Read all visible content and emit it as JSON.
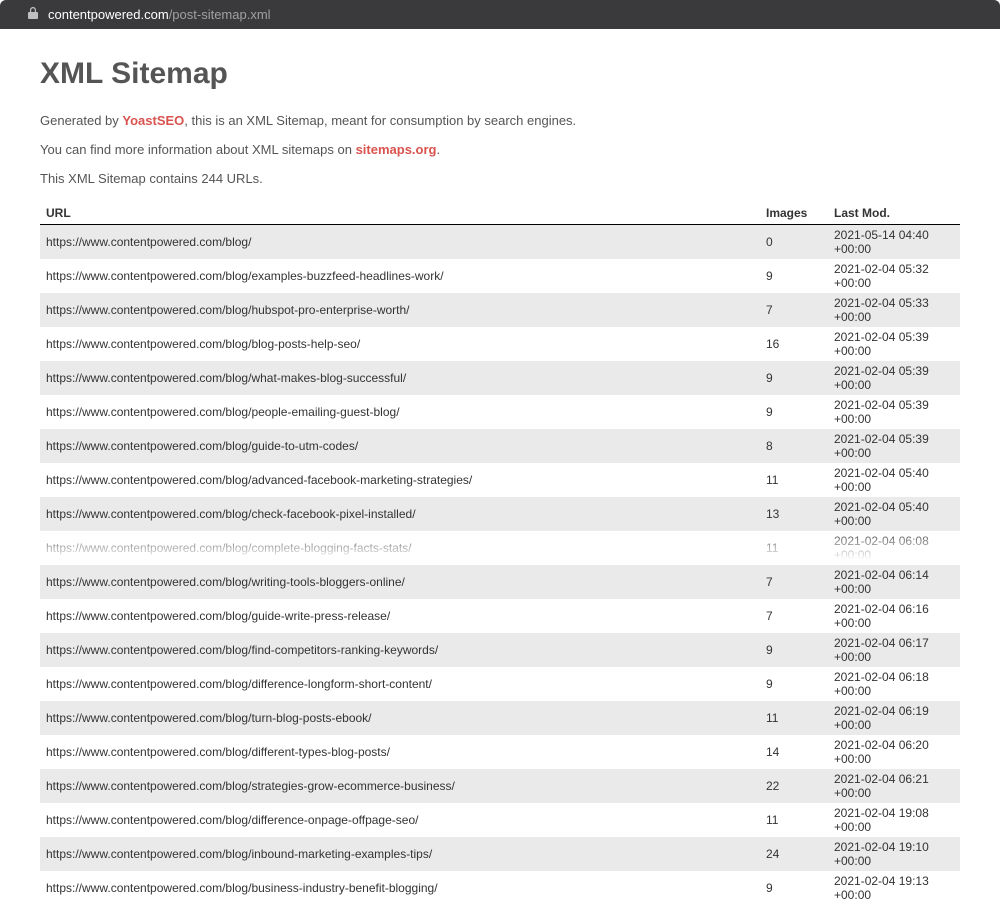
{
  "browser": {
    "domain": "contentpowered.com",
    "path": "/post-sitemap.xml"
  },
  "page": {
    "title": "XML Sitemap",
    "line1_prefix": "Generated by ",
    "line1_link": "YoastSEO",
    "line1_suffix": ", this is an XML Sitemap, meant for consumption by search engines.",
    "line2_prefix": "You can find more information about XML sitemaps on ",
    "line2_link": "sitemaps.org",
    "line2_suffix": ".",
    "count_line": "This XML Sitemap contains 244 URLs."
  },
  "table": {
    "headers": {
      "url": "URL",
      "images": "Images",
      "lastmod": "Last Mod."
    },
    "rows": [
      {
        "url": "https://www.contentpowered.com/blog/",
        "images": "0",
        "lastmod": "2021-05-14 04:40 +00:00"
      },
      {
        "url": "https://www.contentpowered.com/blog/examples-buzzfeed-headlines-work/",
        "images": "9",
        "lastmod": "2021-02-04 05:32 +00:00"
      },
      {
        "url": "https://www.contentpowered.com/blog/hubspot-pro-enterprise-worth/",
        "images": "7",
        "lastmod": "2021-02-04 05:33 +00:00"
      },
      {
        "url": "https://www.contentpowered.com/blog/blog-posts-help-seo/",
        "images": "16",
        "lastmod": "2021-02-04 05:39 +00:00"
      },
      {
        "url": "https://www.contentpowered.com/blog/what-makes-blog-successful/",
        "images": "9",
        "lastmod": "2021-02-04 05:39 +00:00"
      },
      {
        "url": "https://www.contentpowered.com/blog/people-emailing-guest-blog/",
        "images": "9",
        "lastmod": "2021-02-04 05:39 +00:00"
      },
      {
        "url": "https://www.contentpowered.com/blog/guide-to-utm-codes/",
        "images": "8",
        "lastmod": "2021-02-04 05:39 +00:00"
      },
      {
        "url": "https://www.contentpowered.com/blog/advanced-facebook-marketing-strategies/",
        "images": "11",
        "lastmod": "2021-02-04 05:40 +00:00"
      },
      {
        "url": "https://www.contentpowered.com/blog/check-facebook-pixel-installed/",
        "images": "13",
        "lastmod": "2021-02-04 05:40 +00:00"
      },
      {
        "url": "https://www.contentpowered.com/blog/complete-blogging-facts-stats/",
        "images": "11",
        "lastmod": "2021-02-04 06:08 +00:00"
      },
      {
        "url": "https://www.contentpowered.com/blog/writing-tools-bloggers-online/",
        "images": "7",
        "lastmod": "2021-02-04 06:14 +00:00"
      },
      {
        "url": "https://www.contentpowered.com/blog/guide-write-press-release/",
        "images": "7",
        "lastmod": "2021-02-04 06:16 +00:00"
      },
      {
        "url": "https://www.contentpowered.com/blog/find-competitors-ranking-keywords/",
        "images": "9",
        "lastmod": "2021-02-04 06:17 +00:00"
      },
      {
        "url": "https://www.contentpowered.com/blog/difference-longform-short-content/",
        "images": "9",
        "lastmod": "2021-02-04 06:18 +00:00"
      },
      {
        "url": "https://www.contentpowered.com/blog/turn-blog-posts-ebook/",
        "images": "11",
        "lastmod": "2021-02-04 06:19 +00:00"
      },
      {
        "url": "https://www.contentpowered.com/blog/different-types-blog-posts/",
        "images": "14",
        "lastmod": "2021-02-04 06:20 +00:00"
      },
      {
        "url": "https://www.contentpowered.com/blog/strategies-grow-ecommerce-business/",
        "images": "22",
        "lastmod": "2021-02-04 06:21 +00:00"
      },
      {
        "url": "https://www.contentpowered.com/blog/difference-onpage-offpage-seo/",
        "images": "11",
        "lastmod": "2021-02-04 19:08 +00:00"
      },
      {
        "url": "https://www.contentpowered.com/blog/inbound-marketing-examples-tips/",
        "images": "24",
        "lastmod": "2021-02-04 19:10 +00:00"
      },
      {
        "url": "https://www.contentpowered.com/blog/business-industry-benefit-blogging/",
        "images": "9",
        "lastmod": "2021-02-04 19:13 +00:00"
      }
    ]
  }
}
